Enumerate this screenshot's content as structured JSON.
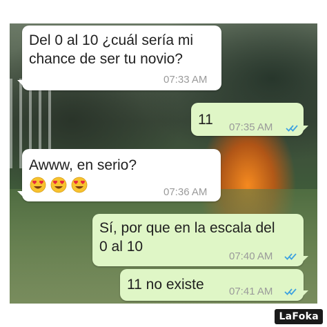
{
  "messages": [
    {
      "direction": "incoming",
      "lines": [
        "Del 0 al 10 ¿cuál sería mi",
        "chance de ser tu novio?"
      ],
      "time": "07:33 AM"
    },
    {
      "direction": "outgoing",
      "lines": [
        "11"
      ],
      "time": "07:35 AM",
      "status": "read"
    },
    {
      "direction": "incoming",
      "lines": [
        "Awww, en serio?"
      ],
      "emoji": [
        "heart-eyes",
        "heart-eyes",
        "heart-eyes"
      ],
      "time": "07:36 AM"
    },
    {
      "direction": "outgoing",
      "lines": [
        "Sí, por que en la escala del",
        "0 al 10"
      ],
      "time": "07:40 AM",
      "status": "read"
    },
    {
      "direction": "outgoing",
      "lines": [
        "11 no existe"
      ],
      "time": "07:41 AM",
      "status": "read"
    }
  ],
  "watermark": "LaFoka",
  "colors": {
    "incoming_bubble": "#ffffff",
    "outgoing_bubble": "#dff6c6",
    "read_ticks": "#3ea2e0",
    "timestamp": "#9a9a9a"
  },
  "icons": {
    "read_receipt": "double-check-icon",
    "emoji": "heart-eyes-emoji-icon"
  }
}
